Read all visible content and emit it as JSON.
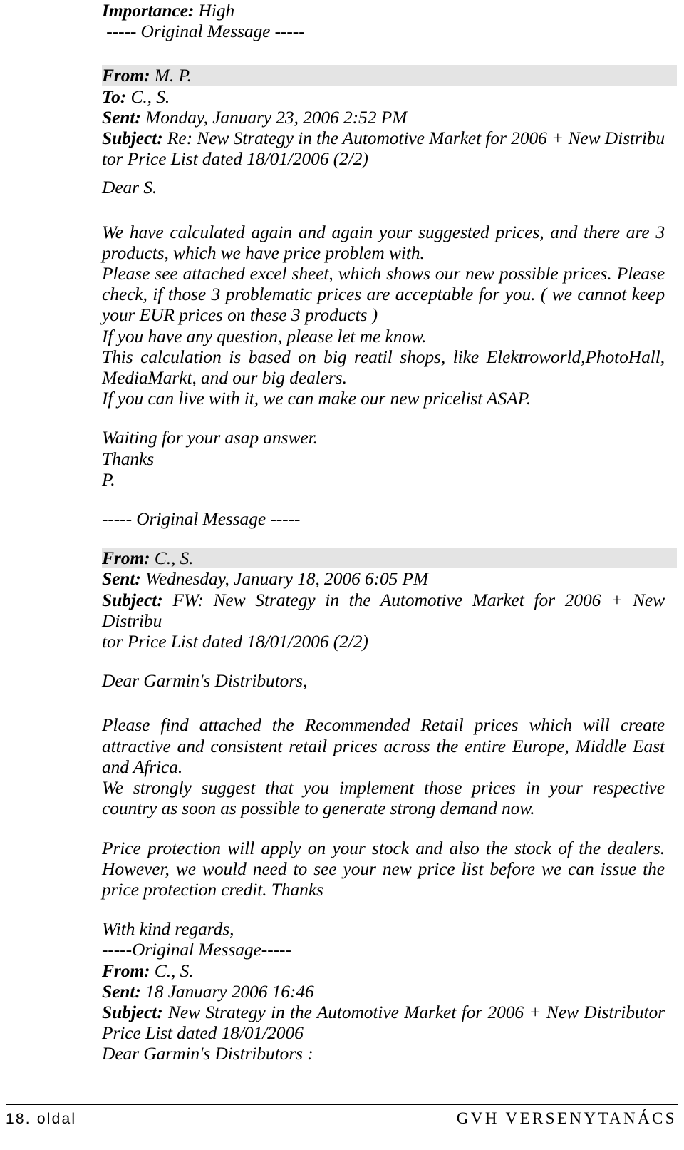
{
  "document": {
    "type": "scanned-email-thread-page",
    "page_label": "18. oldal",
    "publisher": "GVH VERSENYTANÁCS"
  },
  "top": {
    "importance_label": "Importance:",
    "importance_value": "High",
    "original_message_divider": "----- Original Message -----"
  },
  "email1": {
    "from_label": "From:",
    "from_value": "M. P.",
    "to_label": "To:",
    "to_value": "C., S.",
    "sent_label": "Sent:",
    "sent_value": "Monday, January 23, 2006 2:52 PM",
    "subject_label": "Subject:",
    "subject_value": "Re: New Strategy in the Automotive Market for 2006 + New Distribu",
    "subject_wrap": "tor Price List dated 18/01/2006 (2/2)",
    "greeting": "Dear S.",
    "para1": "We have calculated again and again your suggested prices, and there are 3 products, which we have price problem with.",
    "para2_l1": "Please see attached excel sheet, which shows our new possible prices. Please check, if those 3 problematic prices are acceptable for you. ( we cannot keep",
    "para2_l2": "your EUR prices on these 3 products )",
    "para3": "If you have any question, please let me know.",
    "para4_l1": "This calculation is based on big reatil shops, like Elektroworld,PhotoHall, MediaMarkt, and our big dealers.",
    "para5": "If you can live with it, we can make our new pricelist ASAP.",
    "closing1": "Waiting for your asap answer.",
    "closing2": "Thanks",
    "closing3": "P."
  },
  "divider2": "----- Original Message -----",
  "email2": {
    "from_label": "From:",
    "from_value": "C., S.",
    "sent_label": "Sent:",
    "sent_value": "Wednesday, January 18, 2006 6:05 PM",
    "subject_label": "Subject:",
    "subject_value": "FW: New Strategy in the Automotive Market for 2006 + New Distribu",
    "subject_wrap": "tor Price List dated 18/01/2006 (2/2)",
    "greeting": "Dear Garmin's Distributors,",
    "para1": "Please find attached the Recommended Retail prices which will create attractive and consistent retail prices across the entire Europe, Middle East and Africa.",
    "para2": "We strongly suggest that you implement those prices in your respective country as soon as possible to generate strong demand now.",
    "para3": "Price protection will apply on your stock and also the stock of the dealers. However, we would need to see your new price list before we can issue the price protection credit. Thanks",
    "closing": "With kind regards,"
  },
  "divider3": "-----Original Message-----",
  "email3": {
    "from_label": "From:",
    "from_value": "C., S.",
    "sent_label": "Sent:",
    "sent_value": "18 January 2006 16:46",
    "subject_label": "Subject:",
    "subject_value": "New Strategy in the Automotive Market for 2006 + New Distributor",
    "subject_wrap": "Price List dated 18/01/2006",
    "greeting": "Dear Garmin's Distributors :"
  },
  "colors": {
    "text": "#000000",
    "highlight": "#e4e4e4",
    "page_background": "#ffffff"
  }
}
